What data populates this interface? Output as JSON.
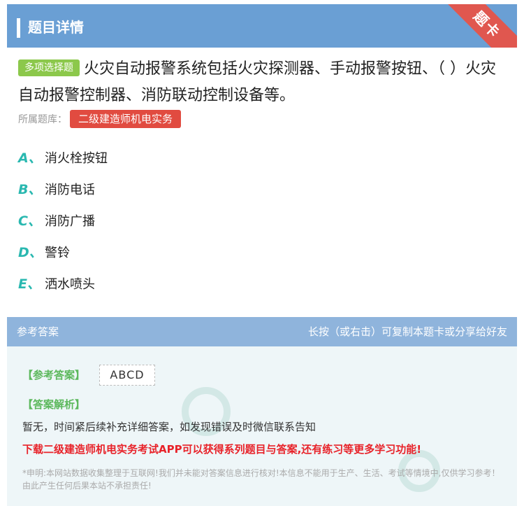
{
  "header": {
    "title": "题目详情",
    "ribbon": "题卡"
  },
  "question": {
    "type_badge": "多项选择题",
    "text": "火灾自动报警系统包括火灾探测器、手动报警按钮、（ ）火灾自动报警控制器、消防联动控制设备等。",
    "bank_label": "所属题库：",
    "bank_name": "二级建造师机电实务"
  },
  "options": [
    {
      "letter": "A、",
      "text": "消火栓按钮"
    },
    {
      "letter": "B、",
      "text": "消防电话"
    },
    {
      "letter": "C、",
      "text": "消防广播"
    },
    {
      "letter": "D、",
      "text": "警铃"
    },
    {
      "letter": "E、",
      "text": "洒水喷头"
    }
  ],
  "answer": {
    "section_title": "参考答案",
    "share_hint": "长按（或右击）可复制本题卡或分享给好友",
    "answer_label": "【参考答案】",
    "answer_value": "ABCD",
    "analysis_label": "【答案解析】",
    "analysis_text": "暂无，时间紧后续补充详细答案，如发现错误及时微信联系告知",
    "promo": "下载二级建造师机电实务考试APP可以获得系列题目与答案,还有练习等更多学习功能!",
    "disclaimer": "*申明:本网站数据收集整理于互联网!我们并未能对答案信息进行核对!本信息不能用于生产、生活、考试等情境中,仅供学习参考！由此产生任何后果本站不承担责任!"
  }
}
